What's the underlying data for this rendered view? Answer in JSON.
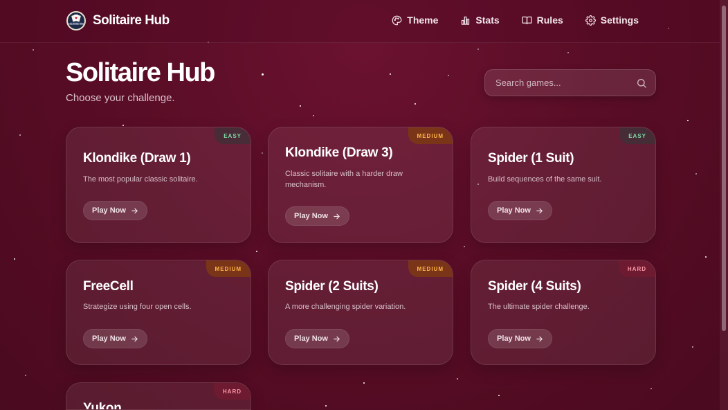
{
  "header": {
    "brand": "Solitaire Hub",
    "logo_text": "SOLITAIRE HUB",
    "nav": [
      {
        "label": "Theme",
        "icon": "palette-icon"
      },
      {
        "label": "Stats",
        "icon": "bar-chart-icon"
      },
      {
        "label": "Rules",
        "icon": "book-icon"
      },
      {
        "label": "Settings",
        "icon": "gear-icon"
      }
    ]
  },
  "hero": {
    "title": "Solitaire Hub",
    "subtitle": "Choose your challenge."
  },
  "search": {
    "placeholder": "Search games...",
    "icon": "search-icon"
  },
  "play_label": "Play Now",
  "games": [
    {
      "title": "Klondike (Draw 1)",
      "description": "The most popular classic solitaire.",
      "difficulty": "EASY"
    },
    {
      "title": "Klondike (Draw 3)",
      "description": "Classic solitaire with a harder draw mechanism.",
      "difficulty": "MEDIUM"
    },
    {
      "title": "Spider (1 Suit)",
      "description": "Build sequences of the same suit.",
      "difficulty": "EASY"
    },
    {
      "title": "FreeCell",
      "description": "Strategize using four open cells.",
      "difficulty": "MEDIUM"
    },
    {
      "title": "Spider (2 Suits)",
      "description": "A more challenging spider variation.",
      "difficulty": "MEDIUM"
    },
    {
      "title": "Spider (4 Suits)",
      "description": "The ultimate spider challenge.",
      "difficulty": "HARD"
    },
    {
      "title": "Yukon",
      "description": "",
      "difficulty": "HARD"
    }
  ],
  "colors": {
    "background": "#5a0d26",
    "easy": "#7fd6a4",
    "medium": "#ffb547",
    "hard": "#ff9aaa"
  }
}
